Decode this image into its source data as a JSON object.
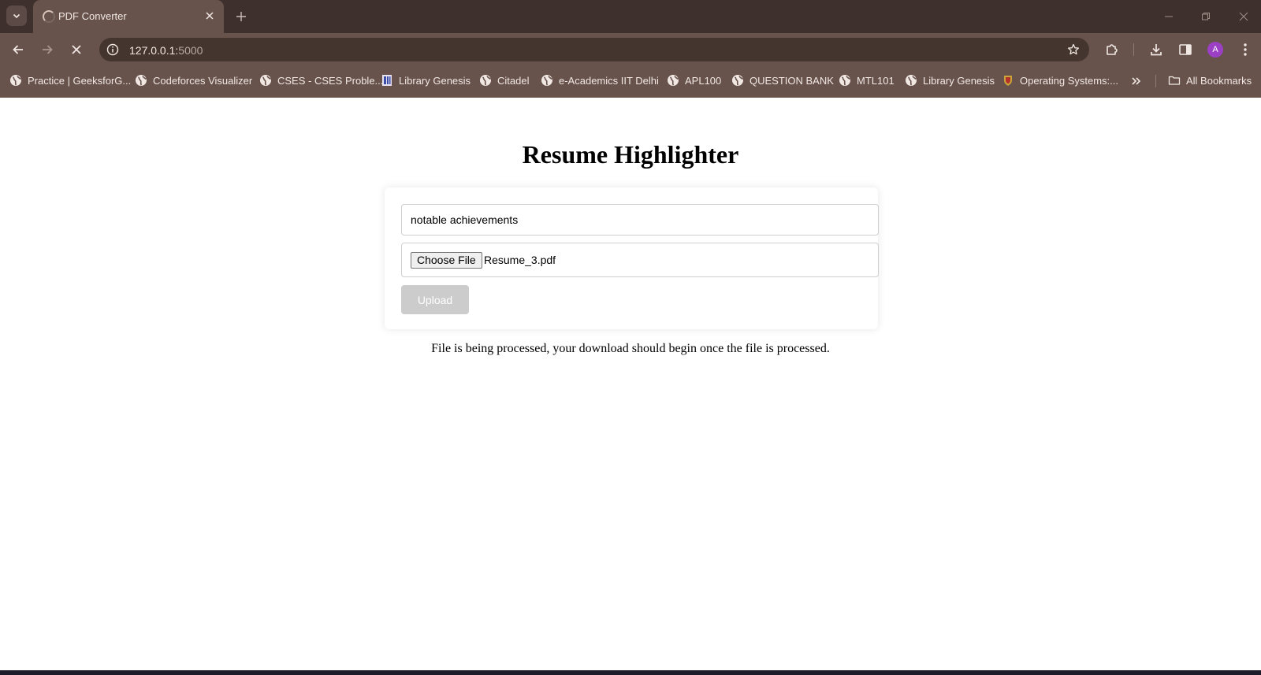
{
  "browser": {
    "tab": {
      "title": "PDF Converter"
    },
    "address": {
      "host": "127.0.0.1:",
      "port": "5000"
    },
    "bookmarks": [
      {
        "label": "Practice | GeeksforG...",
        "icon": "globe-icon"
      },
      {
        "label": "Codeforces Visualizer",
        "icon": "globe-icon"
      },
      {
        "label": "CSES - CSES Proble...",
        "icon": "globe-icon"
      },
      {
        "label": "Library Genesis",
        "icon": "library-icon"
      },
      {
        "label": "Citadel",
        "icon": "globe-icon"
      },
      {
        "label": "e-Academics IIT Delhi",
        "icon": "globe-icon"
      },
      {
        "label": "APL100",
        "icon": "globe-icon"
      },
      {
        "label": "QUESTION BANK",
        "icon": "globe-icon"
      },
      {
        "label": "MTL101",
        "icon": "globe-icon"
      },
      {
        "label": "Library Genesis",
        "icon": "globe-icon"
      },
      {
        "label": "Operating Systems:...",
        "icon": "crest-icon"
      }
    ],
    "all_bookmarks_label": "All Bookmarks",
    "profile_initial": "A",
    "colors": {
      "frame": "#3d302d",
      "toolbar": "#67524c",
      "omnibox": "#45352f",
      "avatar": "#9b40c5"
    }
  },
  "page": {
    "title": "Resume Highlighter",
    "query_input": {
      "value": "notable achievements"
    },
    "file_input": {
      "button_label": "Choose File",
      "file_name": "Resume_3.pdf"
    },
    "upload_button": {
      "label": "Upload",
      "state": "disabled"
    },
    "status_message": "File is being processed, your download should begin once the file is processed."
  }
}
